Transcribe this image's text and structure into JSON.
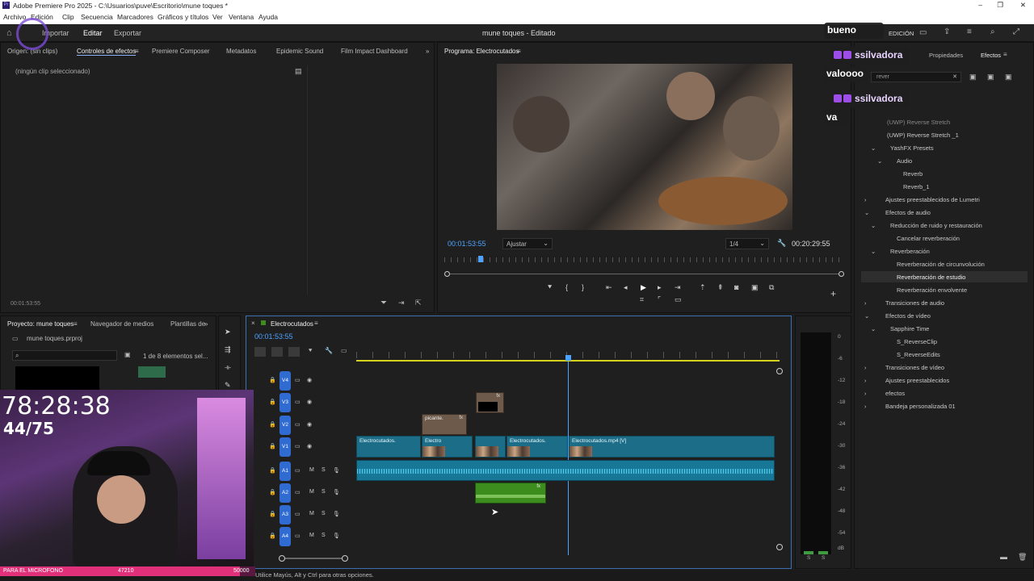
{
  "window": {
    "title": "Adobe Premiere Pro 2025 - C:\\Usuarios\\puve\\Escritorio\\mune toques *",
    "controls": [
      "–",
      "❐",
      "✕"
    ]
  },
  "menu": [
    "Archivo",
    "Edición",
    "Clip",
    "Secuencia",
    "Marcadores",
    "Gráficos y títulos",
    "Ver",
    "Ventana",
    "Ayuda"
  ],
  "appbar": {
    "tabs": [
      "Importar",
      "Editar",
      "Exportar"
    ],
    "project_title": "mune toques - Editado",
    "workspace": "EDICIÓN"
  },
  "source_panel": {
    "tabs": [
      "Origen: (sin clips)",
      "Controles de efectos",
      "Premiere Composer",
      "Metadatos",
      "Epidemic Sound",
      "Film Impact Dashboard"
    ],
    "empty_text": "(ningún clip seleccionado)",
    "timecode": "00:01:53:55"
  },
  "program_panel": {
    "title": "Programa: Electrocutados",
    "timecode": "00:01:53:55",
    "fit": "Ajustar",
    "resolution": "1/4",
    "duration": "00:20:29:55"
  },
  "project_panel": {
    "tabs": [
      "Proyecto: mune toques",
      "Navegador de medios",
      "Plantillas de"
    ],
    "file": "mune toques.prproj",
    "count": "1 de 8 elementos sel..."
  },
  "timeline": {
    "title": "Electrocutados",
    "timecode": "00:01:53:55",
    "video_tracks": [
      "V4",
      "V3",
      "V2",
      "V1"
    ],
    "audio_tracks": [
      "A1",
      "A2",
      "A3",
      "A4"
    ],
    "clips": {
      "v1a": "Electrocutados.",
      "v1b": "Electro",
      "v1c": "Electrocutados.",
      "v1d": "Electrocutados.mp4 [V]",
      "v2": "picante."
    }
  },
  "effects_panel": {
    "tabs": [
      "Propiedades",
      "Efectos"
    ],
    "search": "rever",
    "items": [
      "(UWP) Reverse Stretch",
      "(UWP) Reverse Stretch _1",
      "YashFX Presets",
      "Audio",
      "Reverb",
      "Reverb_1",
      "Ajustes preestablecidos de Lumetri",
      "Efectos de audio",
      "Reducción de ruido y restauración",
      "Cancelar reverberación",
      "Reverberación",
      "Reverberación de circunvolución",
      "Reverberación de estudio",
      "Reverberación envolvente",
      "Transiciones de audio",
      "Efectos de vídeo",
      "Sapphire Time",
      "S_ReverseClip",
      "S_ReverseEdits",
      "Transiciones de vídeo",
      "Ajustes preestablecidos",
      "efectos",
      "Bandeja personalizada 01"
    ]
  },
  "meter": {
    "scale": [
      "0",
      "-6",
      "-12",
      "-18",
      "-24",
      "-30",
      "-36",
      "-42",
      "-48",
      "-54",
      "dB"
    ],
    "solo": [
      "S",
      "S"
    ]
  },
  "status": "Utilice Mayús, Alt y Ctrl para otras opciones.",
  "overlay": {
    "timer": "78:28:38",
    "count": "44/75",
    "mic_label": "PARA EL MICROFONO",
    "mic_value": "47210",
    "mic_goal": "50000"
  },
  "chat": [
    {
      "user": "",
      "msg": "bueno"
    },
    {
      "user": "ssilvadora",
      "msg": "valoooo"
    },
    {
      "user": "ssilvadora",
      "msg": "va"
    }
  ],
  "colors": {
    "accent": "#2f6bd0",
    "clip_blue": "#1c6e88",
    "audio_green": "#3d8c1e",
    "playhead": "#4ea3ff"
  }
}
